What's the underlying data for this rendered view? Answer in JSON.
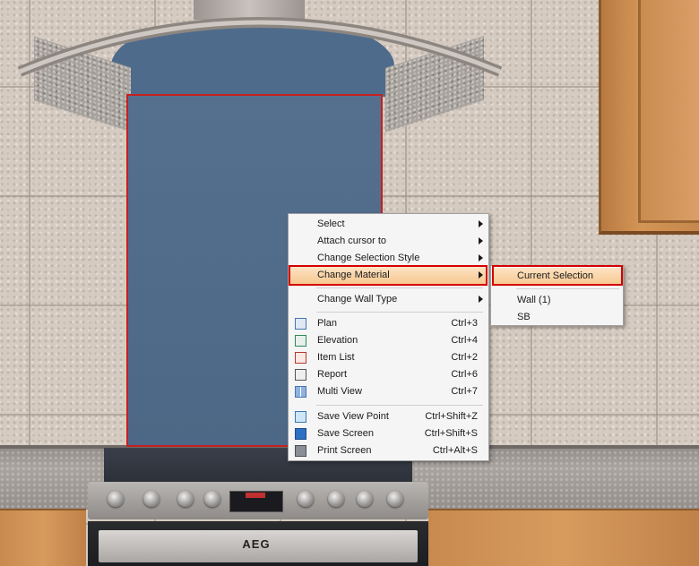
{
  "scene": {
    "oven_brand": "AEG",
    "colors": {
      "splashback": "#4f6b8c",
      "selection_outline": "#c61f1f",
      "highlight_box": "#d40000"
    }
  },
  "context_menu": {
    "items": [
      {
        "label": "Select",
        "submenu": true
      },
      {
        "label": "Attach cursor to",
        "submenu": true
      },
      {
        "label": "Change Selection Style",
        "submenu": true
      },
      {
        "label": "Change Material",
        "submenu": true,
        "highlighted": true
      },
      {
        "label": "Change Wall Type",
        "submenu": true
      },
      {
        "label": "Plan",
        "shortcut": "Ctrl+3",
        "icon": "plan-icon"
      },
      {
        "label": "Elevation",
        "shortcut": "Ctrl+4",
        "icon": "elevation-icon"
      },
      {
        "label": "Item List",
        "shortcut": "Ctrl+2",
        "icon": "item-list-icon"
      },
      {
        "label": "Report",
        "shortcut": "Ctrl+6",
        "icon": "report-icon"
      },
      {
        "label": "Multi View",
        "shortcut": "Ctrl+7",
        "icon": "multi-view-icon"
      },
      {
        "label": "Save View Point",
        "shortcut": "Ctrl+Shift+Z",
        "icon": "save-view-point-icon"
      },
      {
        "label": "Save Screen",
        "shortcut": "Ctrl+Shift+S",
        "icon": "save-screen-icon"
      },
      {
        "label": "Print Screen",
        "shortcut": "Ctrl+Alt+S",
        "icon": "print-screen-icon"
      }
    ]
  },
  "submenu": {
    "items": [
      {
        "label": "Current Selection",
        "highlighted": true
      },
      {
        "label": "Wall (1)"
      },
      {
        "label": "SB"
      }
    ]
  }
}
